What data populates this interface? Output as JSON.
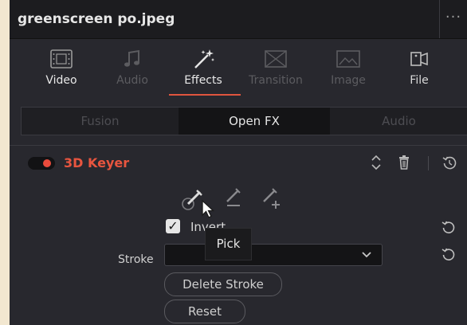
{
  "panel": {
    "title": "greenscreen po.jpeg",
    "menu": "···"
  },
  "tabs": [
    {
      "label": "Video",
      "icon": "film-icon",
      "state": "normal"
    },
    {
      "label": "Audio",
      "icon": "music-note-icon",
      "state": "disabled"
    },
    {
      "label": "Effects",
      "icon": "magic-wand-icon",
      "state": "active"
    },
    {
      "label": "Transition",
      "icon": "transition-icon",
      "state": "disabled"
    },
    {
      "label": "Image",
      "icon": "image-icon",
      "state": "disabled"
    },
    {
      "label": "File",
      "icon": "file-icon",
      "state": "normal"
    }
  ],
  "subtabs": [
    {
      "label": "Fusion",
      "state": "disabled"
    },
    {
      "label": "Open FX",
      "state": "active"
    },
    {
      "label": "Audio",
      "state": "disabled"
    }
  ],
  "effect": {
    "name": "3D Keyer",
    "enabled": true
  },
  "controls": {
    "invert_label": "Invert",
    "invert_checked": true,
    "tooltip": "Pick",
    "stroke_label": "Stroke",
    "stroke_value": "",
    "delete_stroke_label": "Delete Stroke",
    "reset_label": "Reset"
  },
  "colors": {
    "accent": "#e0553e",
    "panel_bg": "#28282e",
    "title_bg": "#1c1c1f",
    "toggle_on": "#ea4b3c"
  }
}
